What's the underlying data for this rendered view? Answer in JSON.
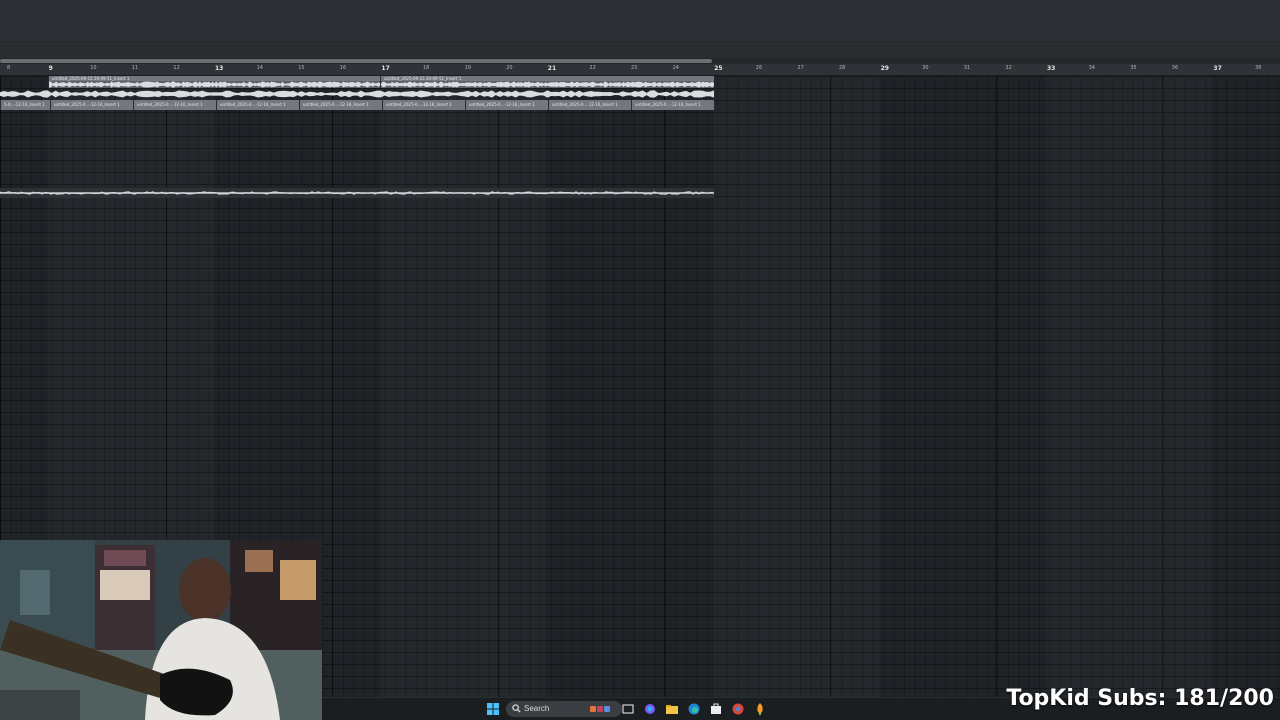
{
  "ruler": {
    "bar_numbers": [
      "8",
      "9",
      "10",
      "11",
      "12",
      "13",
      "14",
      "15",
      "16",
      "17",
      "18",
      "19",
      "20",
      "21",
      "22",
      "23",
      "24",
      "25",
      "26",
      "27",
      "28",
      "29",
      "30",
      "31",
      "32",
      "33",
      "34",
      "35",
      "36",
      "37",
      "38"
    ]
  },
  "playlist": {
    "row1_clips": [
      {
        "name": "untitled_2025-09-15 20-09-51_Insert 1"
      },
      {
        "name": "untitled_2025-09-15 20-09-51_Insert 1"
      }
    ],
    "row2_clip_name": "untitled_2025-0...-12-16_Insert 1",
    "row2_first_clip_name": "5-0...-12-16_Insert 1"
  },
  "taskbar": {
    "search_label": "Search",
    "icons": [
      "windows-start-icon",
      "search-icon",
      "widgets-icon",
      "task-view-icon",
      "copilot-icon",
      "file-explorer-icon",
      "edge-icon",
      "store-icon",
      "chrome-icon",
      "fl-studio-icon"
    ]
  },
  "overlay": {
    "subs_text": "TopKid Subs: 181/200"
  },
  "colors": {
    "clip": "#5d6268",
    "grid_bg": "#1f2327",
    "ruler_bg": "#2f3337",
    "taskbar_bg": "#1b1e21"
  }
}
